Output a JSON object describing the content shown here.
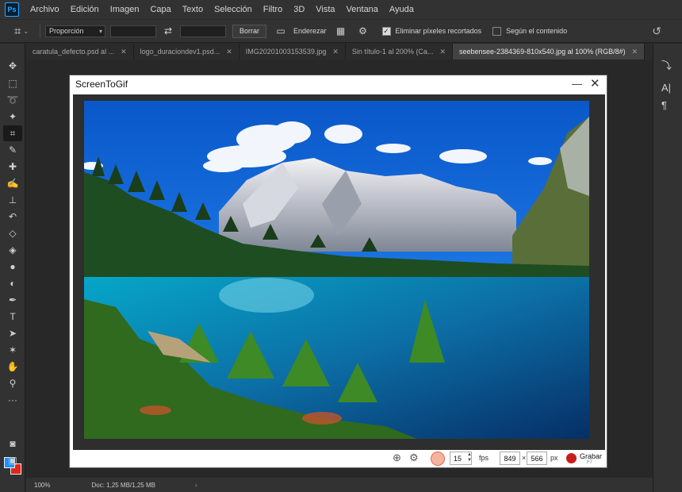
{
  "app": {
    "logo": "Ps"
  },
  "menu": [
    "Archivo",
    "Edición",
    "Imagen",
    "Capa",
    "Texto",
    "Selección",
    "Filtro",
    "3D",
    "Vista",
    "Ventana",
    "Ayuda"
  ],
  "options": {
    "ratio": "Proporción",
    "clear_label": "Borrar",
    "straighten_label": "Enderezar",
    "delete_cropped_label": "Eliminar píxeles recortados",
    "delete_cropped_checked": true,
    "content_aware_label": "Según el contenido",
    "content_aware_checked": false
  },
  "tabs": [
    {
      "label": "caratula_defecto.psd al ...",
      "active": false
    },
    {
      "label": "logo_duraciondev1.psd...",
      "active": false
    },
    {
      "label": "IMG20201003153539.jpg",
      "active": false
    },
    {
      "label": "Sin título-1 al 200% (Ca...",
      "active": false
    },
    {
      "label": "seebensee-2384369-810x540.jpg al 100% (RGB/8#)",
      "active": true
    }
  ],
  "screentogif": {
    "title": "ScreenToGif",
    "fps_value": "15",
    "fps_label": "fps",
    "width_value": "849",
    "times": "×",
    "height_value": "566",
    "px_label": "px",
    "record_label": "Grabar",
    "record_key": "F7"
  },
  "status": {
    "zoom": "100%",
    "doc": "Doc: 1,25 MB/1,25 MB"
  },
  "colors": {
    "foreground": "#1e90ff",
    "background": "#e0251b",
    "record": "#c81d1d"
  }
}
